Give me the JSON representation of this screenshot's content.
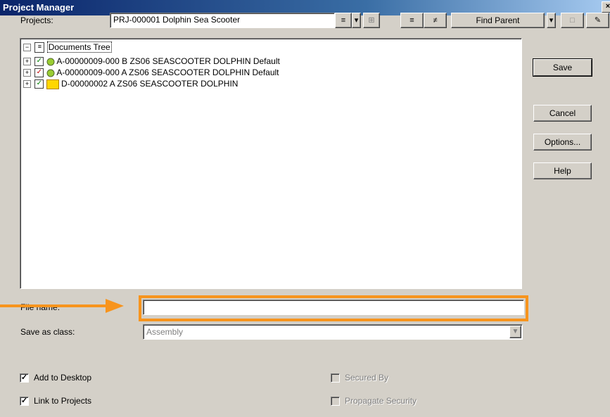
{
  "window": {
    "title": "Project Manager",
    "close_label": "×"
  },
  "projects": {
    "label": "Projects:",
    "value": "PRJ-000001 Dolphin Sea Scooter"
  },
  "toolbar": {
    "find_parent_label": "Find Parent"
  },
  "tree": {
    "root_label": "Documents Tree",
    "items": [
      {
        "label": "A-00000009-000 B ZS06 SEASCOOTER  DOLPHIN Default"
      },
      {
        "label": "A-00000009-000 A ZS06 SEASCOOTER  DOLPHIN Default"
      },
      {
        "label": "D-00000002 A ZS06 SEASCOOTER  DOLPHIN"
      }
    ]
  },
  "buttons": {
    "save": "Save",
    "cancel": "Cancel",
    "options": "Options...",
    "help": "Help"
  },
  "file_name": {
    "label": "File name:",
    "value": ""
  },
  "save_as_class": {
    "label": "Save as class:",
    "value": "Assembly"
  },
  "checkboxes": {
    "add_to_desktop": {
      "label": "Add to Desktop",
      "checked": true
    },
    "link_to_projects": {
      "label": "Link to Projects",
      "checked": true
    },
    "secured_by": {
      "label": "Secured By",
      "checked": false,
      "disabled": true
    },
    "propagate_security": {
      "label": "Propagate Security",
      "checked": false,
      "disabled": true
    }
  },
  "annotation": {
    "color": "#f7941d"
  }
}
